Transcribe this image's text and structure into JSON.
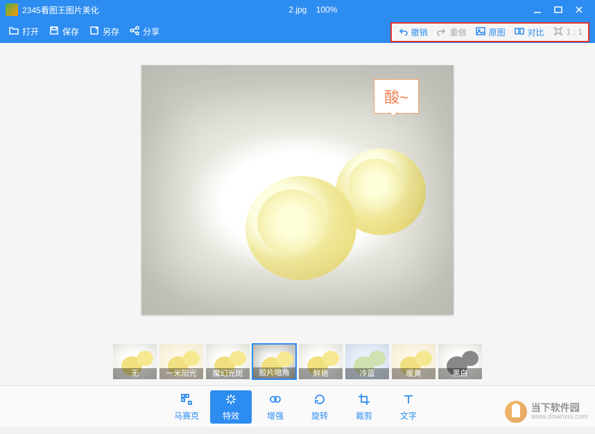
{
  "titlebar": {
    "app_name": "2345看图王图片美化",
    "filename": "2.jpg",
    "zoom": "100%"
  },
  "toolbar": {
    "open": "打开",
    "save": "保存",
    "saveas": "另存",
    "share": "分享",
    "undo": "撤销",
    "redo": "重做",
    "original": "原图",
    "compare": "对比",
    "oneone": "1 : 1"
  },
  "speech_bubble": "酸~",
  "filters": [
    {
      "label": "无",
      "cls": ""
    },
    {
      "label": "一米阳光",
      "cls": "warm"
    },
    {
      "label": "魔幻光斑",
      "cls": ""
    },
    {
      "label": "胶片暗角",
      "cls": "vig"
    },
    {
      "label": "鲜艳",
      "cls": ""
    },
    {
      "label": "冷蓝",
      "cls": "cold"
    },
    {
      "label": "暖黄",
      "cls": "warm"
    },
    {
      "label": "黑白",
      "cls": "bw"
    }
  ],
  "selected_filter_index": 3,
  "bottom_tools": [
    {
      "label": "马赛克",
      "icon": "mosaic"
    },
    {
      "label": "特效",
      "icon": "fx"
    },
    {
      "label": "增强",
      "icon": "enhance"
    },
    {
      "label": "旋转",
      "icon": "rotate"
    },
    {
      "label": "裁剪",
      "icon": "crop"
    },
    {
      "label": "文字",
      "icon": "text"
    }
  ],
  "active_tool_index": 1,
  "watermark": {
    "name": "当下软件园",
    "url": "www.downxia.com"
  }
}
